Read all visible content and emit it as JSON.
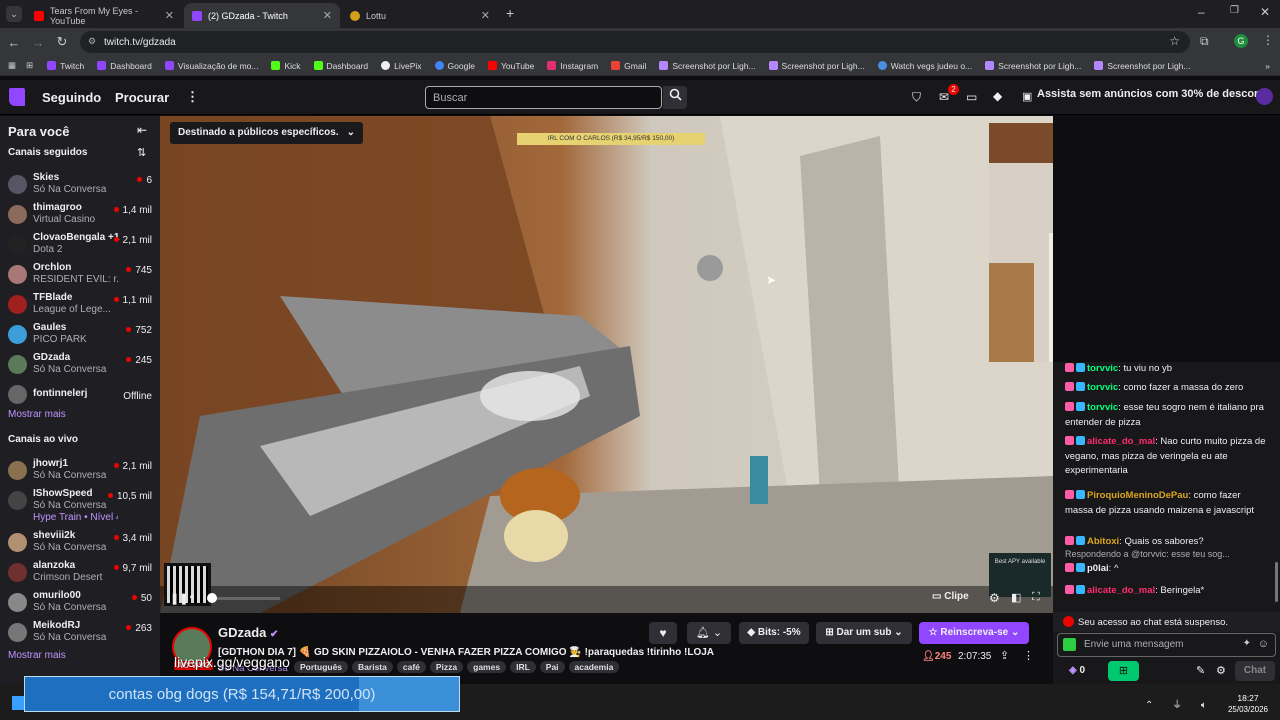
{
  "browser": {
    "tabs": [
      {
        "title": "Tears From My Eyes - YouTube",
        "active": false,
        "favicon_color": "#ff0000"
      },
      {
        "title": "(2) GDzada - Twitch",
        "active": true,
        "favicon_color": "#9146ff"
      },
      {
        "title": "Lottu",
        "active": false,
        "favicon_color": "#d4a017"
      }
    ],
    "url": "twitch.tv/gdzada",
    "bookmarks": [
      "Twitch",
      "Dashboard",
      "Visualização de mo...",
      "Kick",
      "Dashboard",
      "LivePix",
      "Google",
      "YouTube",
      "Instagram",
      "Gmail",
      "Screenshot por Ligh...",
      "Screenshot por Ligh...",
      "Watch vegs judeu o...",
      "Screenshot por Ligh...",
      "Screenshot por Ligh..."
    ],
    "profile_initial": "G"
  },
  "topnav": {
    "following": "Seguindo",
    "browse": "Procurar",
    "search_placeholder": "Buscar",
    "notif_count": "2",
    "promo": "Assista sem anúncios com 30% de desconto"
  },
  "sidebar": {
    "title": "Para você",
    "followed_title": "Canais seguidos",
    "followed": [
      {
        "name": "Skies",
        "game": "Só Na Conversa",
        "viewers": "6",
        "color": "#556"
      },
      {
        "name": "thimagroo",
        "game": "Virtual Casino",
        "viewers": "1,4 mil",
        "color": "#8a6a5a"
      },
      {
        "name": "ClovaoBengala +1",
        "game": "Dota 2",
        "viewers": "2,1 mil",
        "color": "#222"
      },
      {
        "name": "Orchlon",
        "game": "RESIDENT EVIL: r...",
        "viewers": "745",
        "color": "#a77"
      },
      {
        "name": "TFBlade",
        "game": "League of Lege...",
        "viewers": "1,1 mil",
        "color": "#a02020"
      },
      {
        "name": "Gaules",
        "game": "PICO PARK",
        "viewers": "752",
        "color": "#3b9ed8"
      },
      {
        "name": "GDzada",
        "game": "Só Na Conversa",
        "viewers": "245",
        "color": "#5a7a5a"
      },
      {
        "name": "fontinnelerj",
        "game": "",
        "viewers": "Offline",
        "color": "#666"
      }
    ],
    "show_more": "Mostrar mais",
    "live_title": "Canais ao vivo",
    "live": [
      {
        "name": "jhowrj1",
        "game": "Só Na Conversa",
        "viewers": "2,1 mil",
        "color": "#8a7050"
      },
      {
        "name": "IShowSpeed",
        "game": "Só Na Conversa",
        "extra": "Hype Train • Nível 4",
        "viewers": "10,5 mil",
        "color": "#444"
      },
      {
        "name": "sheviii2k",
        "game": "Só Na Conversa",
        "viewers": "3,4 mil",
        "color": "#b09070"
      },
      {
        "name": "alanzoka",
        "game": "Crimson Desert",
        "viewers": "9,7 mil",
        "color": "#703030"
      },
      {
        "name": "omurilo00",
        "game": "Só Na Conversa",
        "viewers": "50",
        "color": "#888"
      },
      {
        "name": "MeikodRJ",
        "game": "Só Na Conversa",
        "viewers": "263",
        "color": "#777"
      }
    ],
    "show_more2": "Mostrar mais"
  },
  "video": {
    "audience_label": "Destinado a públicos específicos.",
    "goal_bar": "IRL COM O CARLOS (R$ 34,95/R$ 150,00)",
    "clip_label": "Clipe",
    "overlay_top": "Best APY available"
  },
  "stream": {
    "channel": "GDzada",
    "title": "[GDTHON DIA 7] 🍕 GD SKIN PIZZAIOLO - VENHA FAZER PIZZA COMIGO 🧑‍🍳 !paraquedas !tirinho !LOJA",
    "tags": [
      "AO VIVO",
      "Só Na Conversa",
      "Português",
      "Barista",
      "café",
      "Pizza",
      "games",
      "IRL",
      "Pai",
      "academia"
    ],
    "livepix": "livepix.gg/veggano",
    "bits": "Bits: -5%",
    "gift_sub": "Dar um sub",
    "resub": "Reinscreva-se",
    "viewers": "245",
    "uptime": "2:07:35"
  },
  "ticker": {
    "text": "contas obg dogs (R$ 154,71/R$ 200,00)",
    "progress_pct": 77
  },
  "chat": {
    "messages": [
      {
        "user": "torvvic",
        "color": "#00ff7f",
        "text": "tu viu no yb"
      },
      {
        "user": "torvvic",
        "color": "#00ff7f",
        "text": "como fazer a massa do zero"
      },
      {
        "user": "torvvic",
        "color": "#00ff7f",
        "text": "esse teu sogro nem é italiano pra entender de pizza"
      },
      {
        "user": "alicate_do_mal",
        "color": "#ff2a6d",
        "text": "Nao curto muito pizza de vegano, mas pizza de veringela eu ate experimentaria"
      },
      {
        "user": "PiroquioMeninoDePau",
        "color": "#daa520",
        "text": "como fazer massa de pizza usando maizena e javascript"
      },
      {
        "user": "Abitoxi",
        "color": "#daa520",
        "text": "Quais os sabores?"
      },
      {
        "user": "p0lai",
        "color": "#efeff1",
        "text": "^",
        "reply": "Respondendo a @torvvic: esse teu sog..."
      },
      {
        "user": "alicate_do_mal",
        "color": "#ff2a6d",
        "text": "Beringela*"
      }
    ],
    "suspended": "Seu acesso ao chat está suspenso.",
    "input_placeholder": "Envie uma mensagem",
    "points": "0",
    "chat_button": "Chat"
  },
  "taskbar": {
    "time": "18:27",
    "date": "25/03/2026"
  }
}
